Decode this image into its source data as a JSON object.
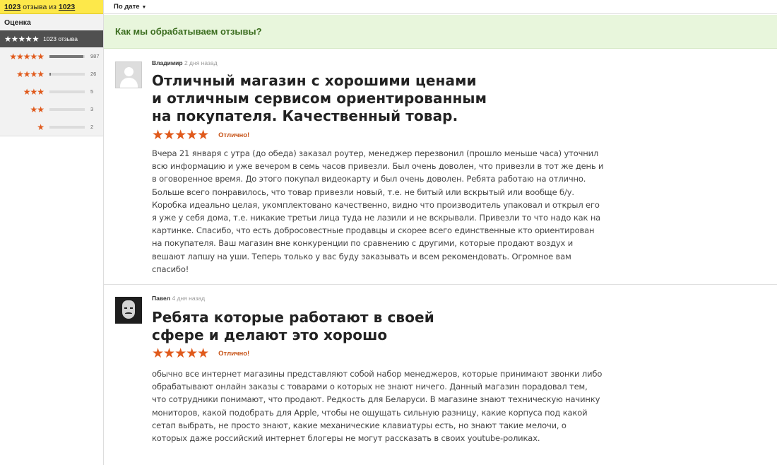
{
  "summary": {
    "count": "1023",
    "mid_text": " отзыва из ",
    "total": "1023"
  },
  "filter": {
    "title": "Оценка",
    "active": {
      "stars": "★★★★★",
      "label": "1023 отзыва"
    },
    "rows": [
      {
        "stars": "★★★★★",
        "count": "987",
        "fraction": 0.96
      },
      {
        "stars": "★★★★",
        "count": "26",
        "fraction": 0.03
      },
      {
        "stars": "★★★",
        "count": "5",
        "fraction": 0
      },
      {
        "stars": "★★",
        "count": "3",
        "fraction": 0
      },
      {
        "stars": "★",
        "count": "2",
        "fraction": 0
      }
    ]
  },
  "sort": {
    "label": "По дате",
    "caret": "▼"
  },
  "banner": {
    "text": "Как мы обрабатываем отзывы?"
  },
  "reviews": [
    {
      "author": "Владимир",
      "time": "2 дня назад",
      "avatar": "default-avatar",
      "title": "Отличный магазин с хорошими ценами и отличным сервисом ориентированным на покупателя. Качественный товар.",
      "stars": "★★★★★",
      "rating": 5,
      "verdict": "Отлично!",
      "text": "Вчера 21 января с утра (до обеда) заказал роутер, менеджер перезвонил (прошло меньше часа) уточнил всю информацию и уже вечером в семь часов привезли. Был очень доволен, что привезли в тот же день и в оговоренное время. До этого покупал видеокарту и был очень доволен. Ребята работаю на отлично. Больше всего понравилось, что товар привезли новый, т.е. не битый или вскрытый или вообще б/у. Коробка идеально целая, укомплектовано качественно, видно что производитель упаковал и открыл его я уже у себя дома, т.е. никакие третьи лица туда не лазили и не вскрывали. Привезли то что надо как на картинке. Спасибо, что есть добросовестные продавцы и скорее всего единственные кто ориентирован на покупателя. Ваш магазин вне конкуренции по сравнению с другими, которые продают воздух и вешают лапшу на уши. Теперь только у вас буду заказывать и всем рекомендовать. Огромное вам спасибо!"
    },
    {
      "author": "Павел",
      "time": "4 дня назад",
      "avatar": "mask-avatar",
      "title": "Ребята которые работают в своей сфере и делают это хорошо",
      "stars": "★★★★★",
      "rating": 5,
      "verdict": "Отлично!",
      "text": "обычно все интернет магазины представляют собой набор менеджеров, которые принимают звонки либо обрабатывают онлайн заказы с товарами о которых не знают ничего. Данный магазин порадовал тем, что сотрудники понимают, что продают. Редкость для Беларуси. В магазине знают техническую начинку мониторов, какой подобрать для Apple, чтобы не ощущать сильную разницу, какие корпуса под какой сетап выбрать, не просто знают, какие механические клавиатуры есть, но знают такие мелочи, о которых даже российский интернет блогеры не могут рассказать в своих youtube-роликах."
    }
  ],
  "colors": {
    "star": "#e05a1c",
    "header_yellow": "#fde84a",
    "banner_bg": "#e8f6dc",
    "banner_text": "#3b6d1f"
  }
}
